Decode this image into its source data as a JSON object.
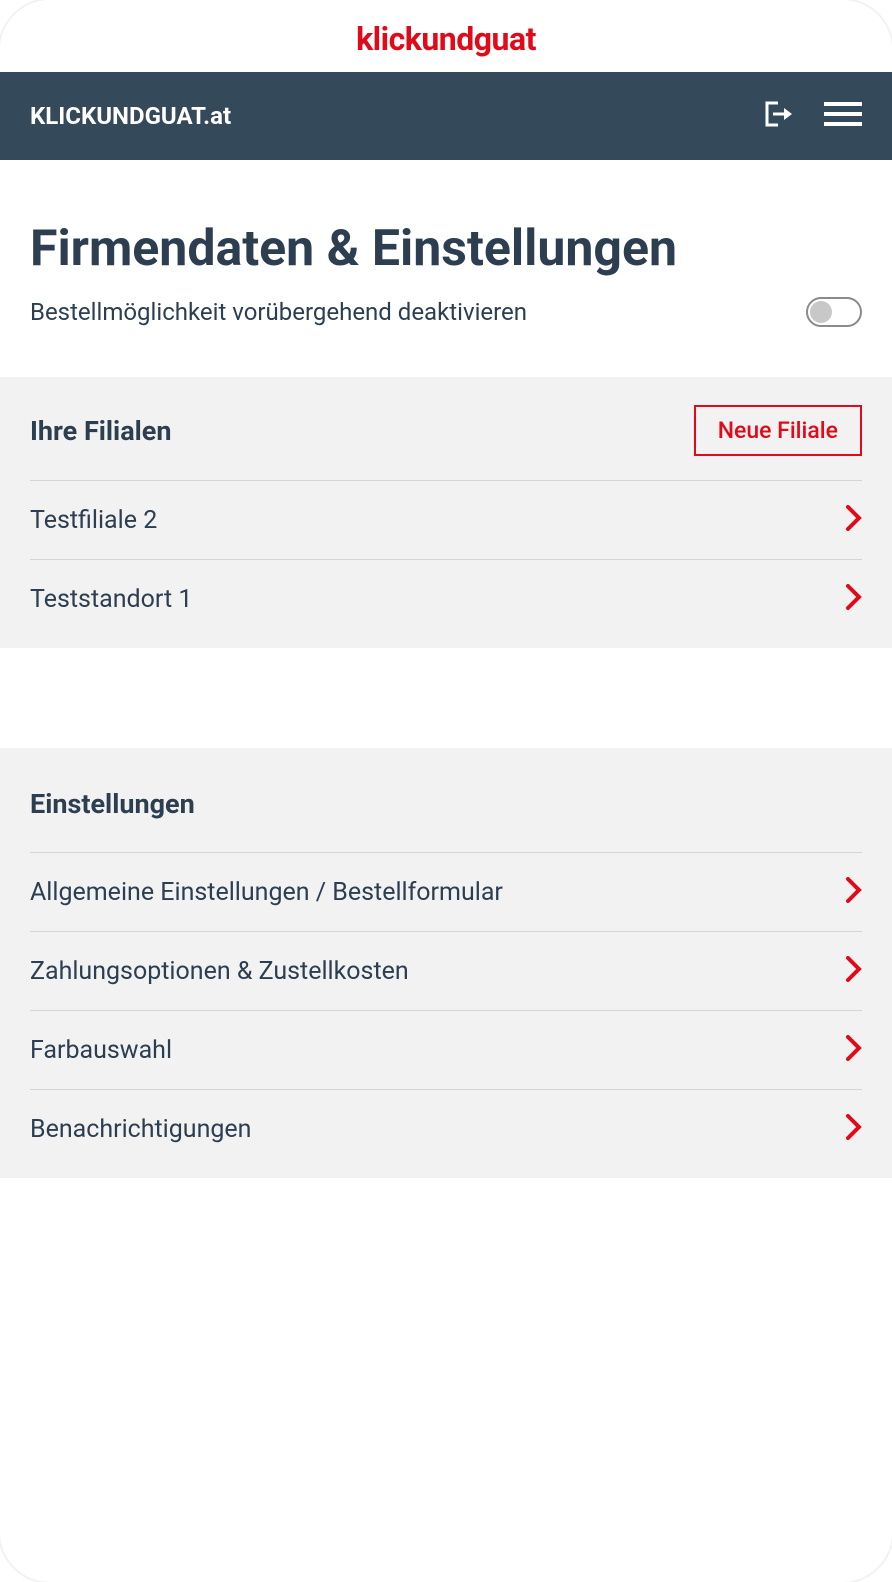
{
  "brand": {
    "logo": "klickundguat"
  },
  "nav": {
    "domain": "KLICKUNDGUAT.at"
  },
  "main": {
    "title": "Firmendaten & Einstellungen",
    "toggle_label": "Bestellmöglichkeit vorübergehend deaktivieren"
  },
  "branches": {
    "title": "Ihre Filialen",
    "new_button": "Neue Filiale",
    "items": [
      {
        "label": "Testfiliale 2"
      },
      {
        "label": "Teststandort 1"
      }
    ]
  },
  "settings": {
    "title": "Einstellungen",
    "items": [
      {
        "label": "Allgemeine Einstellungen / Bestellformular"
      },
      {
        "label": "Zahlungsoptionen & Zustellkosten"
      },
      {
        "label": "Farbauswahl"
      },
      {
        "label": "Benachrichtigungen"
      }
    ]
  }
}
